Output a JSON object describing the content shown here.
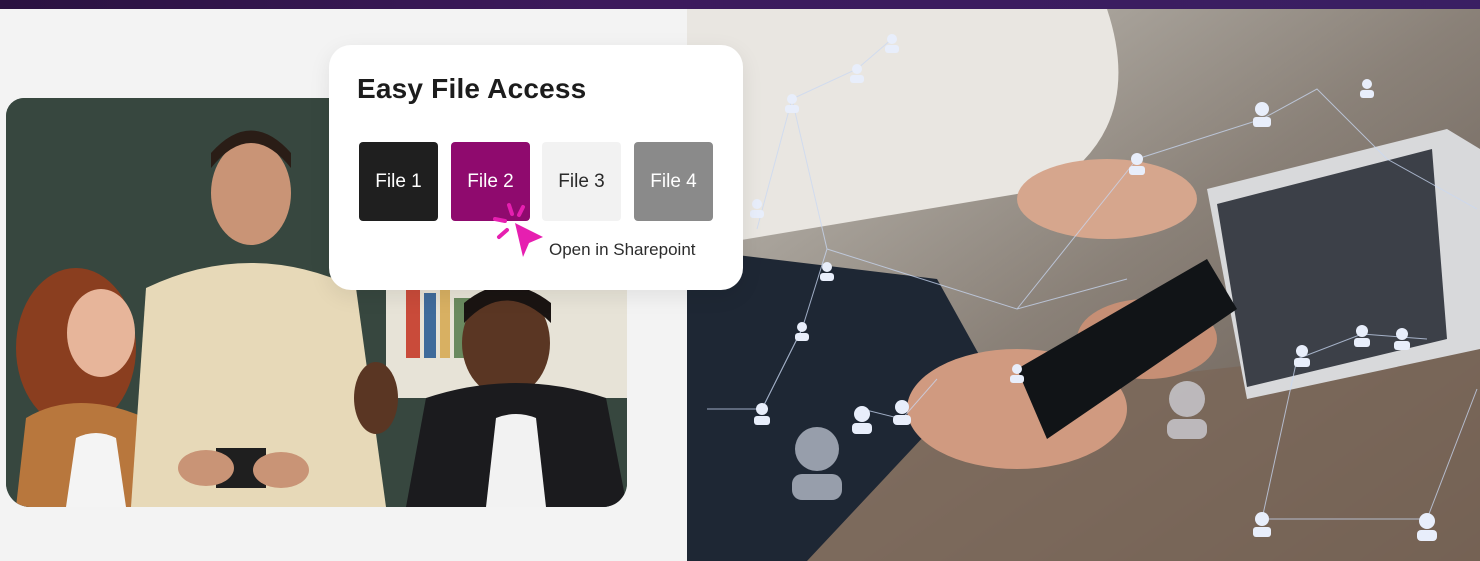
{
  "card": {
    "title": "Easy File Access",
    "files": [
      "File 1",
      "File 2",
      "File 3",
      "File 4"
    ],
    "hint": "Open in Sharepoint"
  },
  "colors": {
    "top_bar": "#3d1a5c",
    "file_1": "#1f1f1f",
    "file_2": "#8f0a6e",
    "file_3": "#f2f2f2",
    "file_4": "#8a8a8a",
    "cursor": "#e61fb0"
  },
  "icons": {
    "cursor": "pointer-click-icon"
  }
}
